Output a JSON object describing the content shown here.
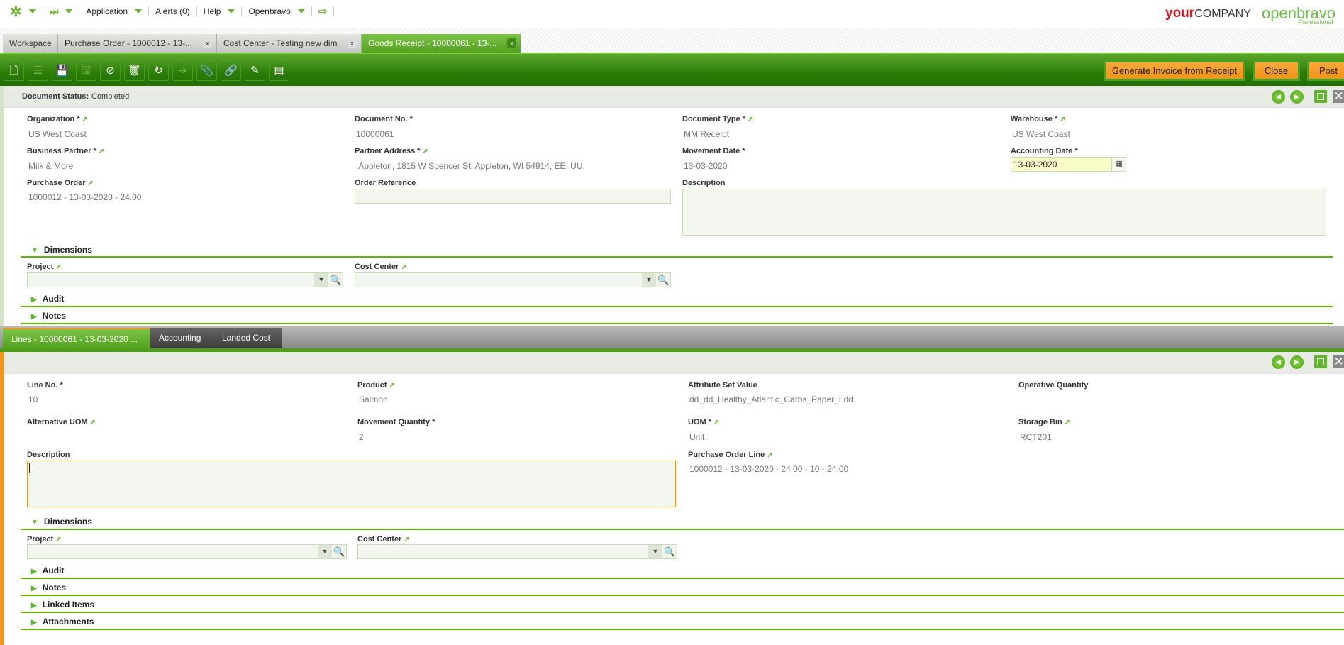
{
  "topnav": {
    "application": "Application",
    "alerts": "Alerts (0)",
    "help": "Help",
    "user": "Openbravo"
  },
  "logos": {
    "company_your": "your",
    "company_rest": "COMPANY",
    "openbravo": "openbravo",
    "edition": "Professional"
  },
  "tabs": [
    {
      "label": "Workspace"
    },
    {
      "label": "Purchase Order - 1000012 - 13-..."
    },
    {
      "label": "Cost Center - Testing new dim"
    },
    {
      "label": "Goods Receipt - 10000061 - 13-..."
    }
  ],
  "tab_close": "x",
  "toolbar": {
    "generate_invoice": "Generate Invoice from Receipt",
    "close": "Close",
    "post": "Post"
  },
  "header": {
    "status_label": "Document Status:",
    "status_value": "Completed",
    "fields": {
      "organization": {
        "label": "Organization *",
        "value": "US West Coast"
      },
      "document_no": {
        "label": "Document No. *",
        "value": "10000061"
      },
      "document_type": {
        "label": "Document Type *",
        "value": "MM Receipt"
      },
      "warehouse": {
        "label": "Warehouse *",
        "value": "US West Coast"
      },
      "business_partner": {
        "label": "Business Partner *",
        "value": "Milk & More"
      },
      "partner_address": {
        "label": "Partner Address *",
        "value": ".Appleton, 1815 W Spencer St, Appleton, WI 54914, EE. UU."
      },
      "movement_date": {
        "label": "Movement Date *",
        "value": "13-03-2020"
      },
      "accounting_date": {
        "label": "Accounting Date *",
        "value": "13-03-2020"
      },
      "purchase_order": {
        "label": "Purchase Order",
        "value": "1000012 - 13-03-2020 - 24.00"
      },
      "order_reference": {
        "label": "Order Reference",
        "value": ""
      },
      "description": {
        "label": "Description",
        "value": ""
      },
      "project": {
        "label": "Project",
        "value": ""
      },
      "cost_center": {
        "label": "Cost Center",
        "value": ""
      }
    },
    "sections": {
      "dimensions": "Dimensions",
      "audit": "Audit",
      "notes": "Notes"
    }
  },
  "subtabs": [
    {
      "label": "Lines - 10000061 - 13-03-2020 ..."
    },
    {
      "label": "Accounting"
    },
    {
      "label": "Landed Cost"
    }
  ],
  "lines": {
    "fields": {
      "line_no": {
        "label": "Line No. *",
        "value": "10"
      },
      "product": {
        "label": "Product",
        "value": "Salmon"
      },
      "attribute_set_value": {
        "label": "Attribute Set Value",
        "value": "dd_dd_Healthy_Atlantic_Carbs_Paper_Ldd"
      },
      "operative_quantity": {
        "label": "Operative Quantity",
        "value": ""
      },
      "alternative_uom": {
        "label": "Alternative UOM",
        "value": ""
      },
      "movement_quantity": {
        "label": "Movement Quantity *",
        "value": "2"
      },
      "uom": {
        "label": "UOM *",
        "value": "Unit"
      },
      "storage_bin": {
        "label": "Storage Bin",
        "value": "RCT201"
      },
      "description": {
        "label": "Description",
        "value": ""
      },
      "purchase_order_line": {
        "label": "Purchase Order Line",
        "value": "1000012 - 13-03-2020 - 24.00 - 10 - 24.00"
      },
      "project": {
        "label": "Project",
        "value": ""
      },
      "cost_center": {
        "label": "Cost Center",
        "value": ""
      }
    },
    "sections": {
      "dimensions": "Dimensions",
      "audit": "Audit",
      "notes": "Notes",
      "linked_items": "Linked Items",
      "attachments": "Attachments"
    }
  },
  "colors": {
    "brand_green": "#5db800",
    "accent_orange": "#f7941d"
  }
}
